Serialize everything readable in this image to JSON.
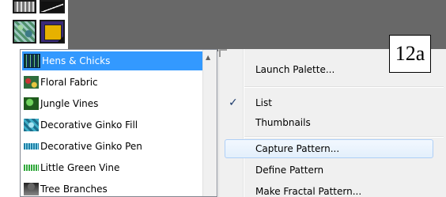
{
  "pattern_list": {
    "items": [
      {
        "label": "Hens & Chicks",
        "icon": "hens-chicks-pattern-icon",
        "selected": true
      },
      {
        "label": "Floral Fabric",
        "icon": "floral-fabric-pattern-icon",
        "selected": false
      },
      {
        "label": "Jungle Vines",
        "icon": "jungle-vines-pattern-icon",
        "selected": false
      },
      {
        "label": "Decorative Ginko Fill",
        "icon": "ginko-fill-pattern-icon",
        "selected": false
      },
      {
        "label": "Decorative Ginko Pen",
        "icon": "ginko-pen-pattern-icon",
        "selected": false
      },
      {
        "label": "Little Green Vine",
        "icon": "green-vine-pattern-icon",
        "selected": false
      },
      {
        "label": "Tree Branches",
        "icon": "tree-branches-pattern-icon",
        "selected": false
      }
    ]
  },
  "context_menu": {
    "launch_palette": "Launch Palette...",
    "list": "List",
    "thumbnails": "Thumbnails",
    "capture_pattern": "Capture Pattern...",
    "define_pattern": "Define Pattern",
    "make_fractal_pattern": "Make Fractal Pattern...",
    "checked_item": "List",
    "check_mark": "✓"
  },
  "figure_label": "12a",
  "colors": {
    "selection": "#3399ff",
    "menu_background": "#f0f0f0",
    "hover_border": "#aecff7"
  }
}
